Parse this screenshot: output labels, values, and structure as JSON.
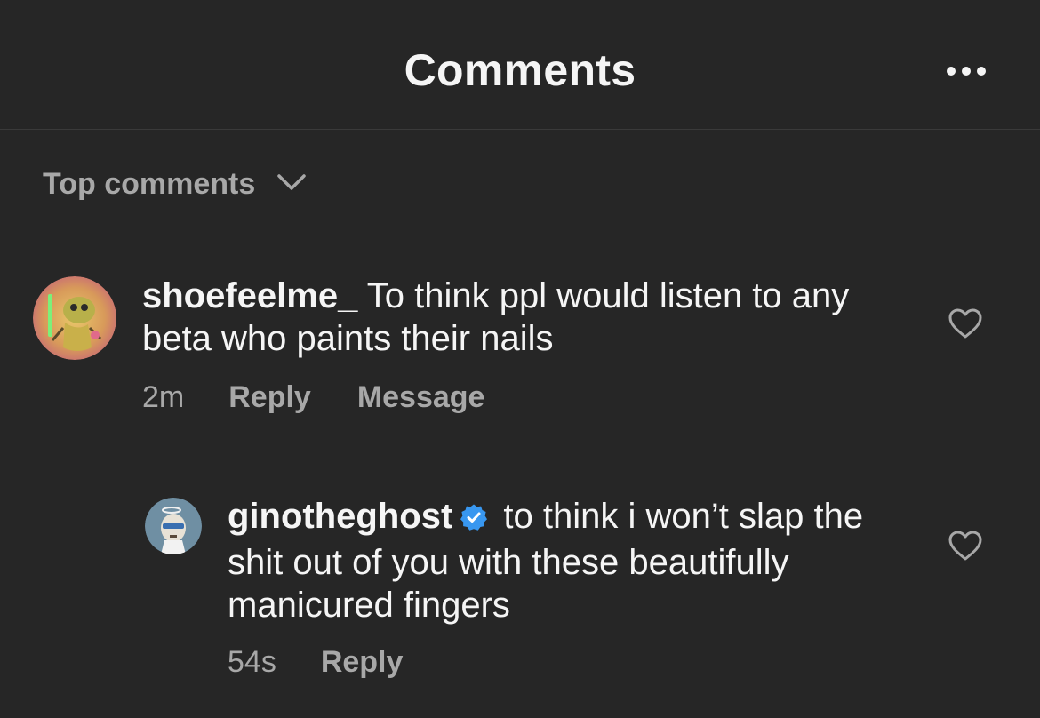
{
  "header": {
    "title": "Comments",
    "more_icon": "more-horizontal-icon"
  },
  "sort": {
    "label": "Top comments",
    "icon": "chevron-down-icon"
  },
  "comments": [
    {
      "username": "shoefeelme_",
      "text": "To think ppl would listen to any beta who paints their nails",
      "time": "2m",
      "actions": [
        "Reply",
        "Message"
      ],
      "like_icon": "heart-outline-icon"
    },
    {
      "username": "ginotheghost",
      "verified": true,
      "text": "to think i won’t slap the shit out of you with these beautifully manicured fingers",
      "time": "54s",
      "actions": [
        "Reply"
      ],
      "like_icon": "heart-outline-icon"
    }
  ],
  "colors": {
    "background": "#262626",
    "primary_text": "#f5f5f5",
    "secondary_text": "#a8a8a8",
    "verified_badge": "#3897f0"
  }
}
